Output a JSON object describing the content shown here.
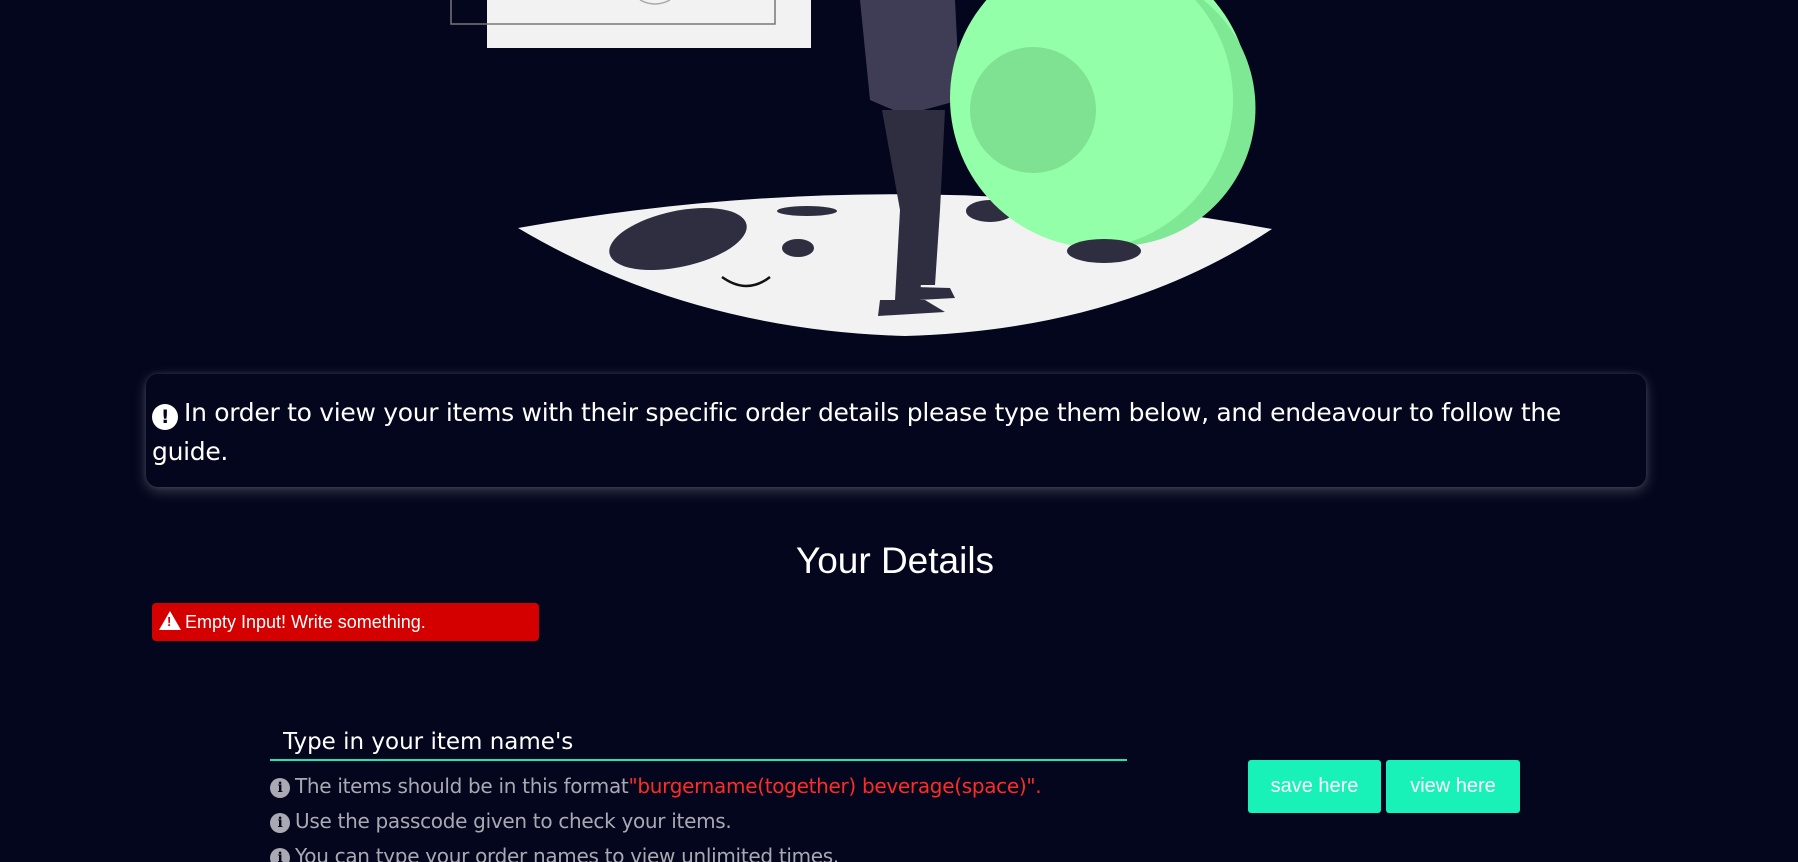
{
  "notice": {
    "text": "In order to view your items with their specific order details please type them below, and endeavour to follow the guide."
  },
  "details": {
    "title": "Your Details",
    "error_message": "Empty Input! Write something."
  },
  "form": {
    "item_placeholder": "Type in your item name's",
    "guide_format_prefix": "The items should be in this format",
    "guide_format_example": "\"burgername(together) beverage(space)\".",
    "guide_passcode": "Use the passcode given to check your items.",
    "guide_unlimited": "You can type your order names to view unlimited times.",
    "save_label": "save here",
    "view_label": "view here"
  },
  "colors": {
    "background": "#03061c",
    "accent": "#18f2b8",
    "error": "#d40000",
    "highlight": "#ff2a2a",
    "illustration_green": "#93ffa8"
  },
  "icons": {
    "notice": "exclamation-circle-icon",
    "error": "warning-triangle-icon",
    "guide": "info-circle-icon"
  }
}
